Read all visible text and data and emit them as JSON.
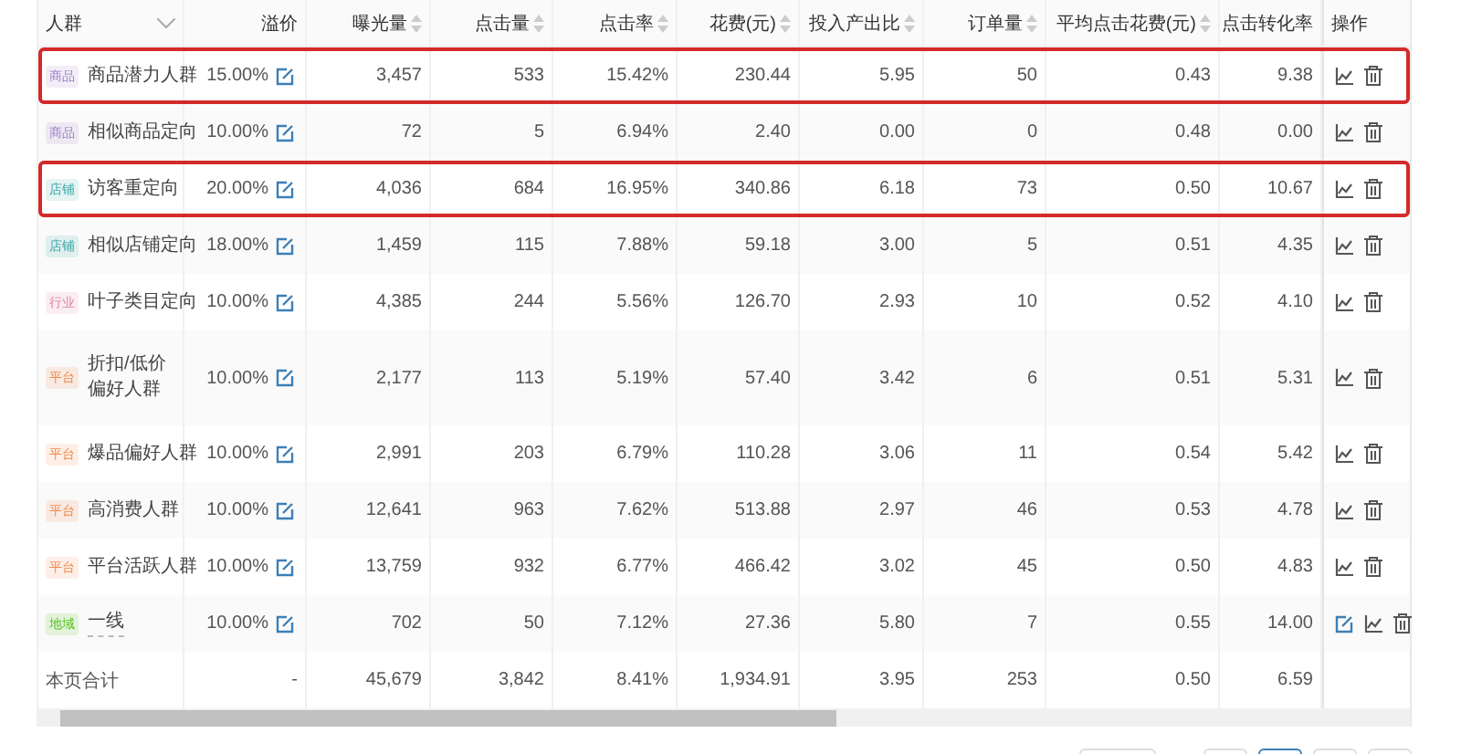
{
  "table": {
    "columns": [
      {
        "label": "人群",
        "kind": "filter"
      },
      {
        "label": "溢价",
        "kind": "plain"
      },
      {
        "label": "曝光量",
        "kind": "sortable"
      },
      {
        "label": "点击量",
        "kind": "sortable"
      },
      {
        "label": "点击率",
        "kind": "sortable"
      },
      {
        "label": "花费(元)",
        "kind": "sortable"
      },
      {
        "label": "投入产出比",
        "kind": "sortable"
      },
      {
        "label": "订单量",
        "kind": "sortable"
      },
      {
        "label": "平均点击花费(元)",
        "kind": "sortable"
      },
      {
        "label": "点击转化率",
        "kind": "plain"
      },
      {
        "label": "操作",
        "kind": "plain"
      }
    ],
    "rows": [
      {
        "tag": {
          "text": "商品",
          "color": "#9b7fc9"
        },
        "name": "商品潜力人群",
        "highlighted": true,
        "underlined": false,
        "premium": "15.00%",
        "values": [
          "3,457",
          "533",
          "15.42%",
          "230.44",
          "5.95",
          "50",
          "0.43",
          "9.38"
        ],
        "editable": false
      },
      {
        "tag": {
          "text": "商品",
          "color": "#9b7fc9"
        },
        "name": "相似商品定向",
        "highlighted": false,
        "underlined": false,
        "premium": "10.00%",
        "values": [
          "72",
          "5",
          "6.94%",
          "2.40",
          "0.00",
          "0",
          "0.48",
          "0.00"
        ],
        "editable": false
      },
      {
        "tag": {
          "text": "店铺",
          "color": "#3aa8a8"
        },
        "name": "访客重定向",
        "highlighted": true,
        "underlined": false,
        "premium": "20.00%",
        "values": [
          "4,036",
          "684",
          "16.95%",
          "340.86",
          "6.18",
          "73",
          "0.50",
          "10.67"
        ],
        "editable": false
      },
      {
        "tag": {
          "text": "店铺",
          "color": "#3aa8a8"
        },
        "name": "相似店铺定向",
        "highlighted": false,
        "underlined": false,
        "premium": "18.00%",
        "values": [
          "1,459",
          "115",
          "7.88%",
          "59.18",
          "3.00",
          "5",
          "0.51",
          "4.35"
        ],
        "editable": false
      },
      {
        "tag": {
          "text": "行业",
          "color": "#e07fa6"
        },
        "name": "叶子类目定向",
        "highlighted": false,
        "underlined": false,
        "premium": "10.00%",
        "values": [
          "4,385",
          "244",
          "5.56%",
          "126.70",
          "2.93",
          "10",
          "0.52",
          "4.10"
        ],
        "editable": false
      },
      {
        "tag": {
          "text": "平台",
          "color": "#f08a4b"
        },
        "name": "折扣/低价偏好人群",
        "highlighted": false,
        "underlined": false,
        "premium": "10.00%",
        "values": [
          "2,177",
          "113",
          "5.19%",
          "57.40",
          "3.42",
          "6",
          "0.51",
          "5.31"
        ],
        "editable": false
      },
      {
        "tag": {
          "text": "平台",
          "color": "#f08a4b"
        },
        "name": "爆品偏好人群",
        "highlighted": false,
        "underlined": false,
        "premium": "10.00%",
        "values": [
          "2,991",
          "203",
          "6.79%",
          "110.28",
          "3.06",
          "11",
          "0.54",
          "5.42"
        ],
        "editable": false
      },
      {
        "tag": {
          "text": "平台",
          "color": "#f08a4b"
        },
        "name": "高消费人群",
        "highlighted": false,
        "underlined": false,
        "premium": "10.00%",
        "values": [
          "12,641",
          "963",
          "7.62%",
          "513.88",
          "2.97",
          "46",
          "0.53",
          "4.78"
        ],
        "editable": false
      },
      {
        "tag": {
          "text": "平台",
          "color": "#f08a4b"
        },
        "name": "平台活跃人群",
        "highlighted": false,
        "underlined": false,
        "premium": "10.00%",
        "values": [
          "13,759",
          "932",
          "6.77%",
          "466.42",
          "3.02",
          "45",
          "0.50",
          "4.83"
        ],
        "editable": false
      },
      {
        "tag": {
          "text": "地域",
          "color": "#52c41a"
        },
        "name": "一线",
        "highlighted": false,
        "underlined": true,
        "premium": "10.00%",
        "values": [
          "702",
          "50",
          "7.12%",
          "27.36",
          "5.80",
          "7",
          "0.55",
          "14.00"
        ],
        "editable": true
      }
    ],
    "total": {
      "label": "本页合计",
      "premium": "-",
      "values": [
        "45,679",
        "3,842",
        "8.41%",
        "1,934.91",
        "3.95",
        "253",
        "0.50",
        "6.59"
      ]
    }
  }
}
